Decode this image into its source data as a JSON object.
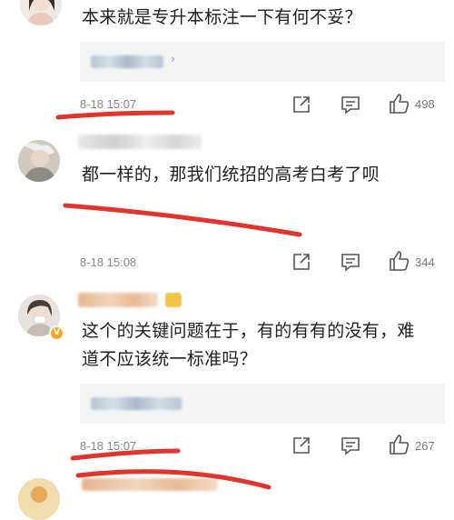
{
  "comments": [
    {
      "text": "本来就是专升本标注一下有何不妥？",
      "time": "8-18 15:07",
      "likes": "498",
      "reply_more": "›"
    },
    {
      "text": "都一样的，那我们统招的高考白考了呗",
      "time": "8-18 15:08",
      "likes": "344"
    },
    {
      "text_line1": "这个的关键问题在于，有的有有的没有，难",
      "text_line2": "道不应该统一标准吗？",
      "time": "8-18 15:07",
      "likes": "267"
    }
  ],
  "icons": {
    "share": "share-icon",
    "comment": "comment-icon",
    "like": "thumbs-up-icon",
    "verified": "verified-badge-icon"
  },
  "colors": {
    "annotation_red": "#e2342a",
    "time_gray": "#888888",
    "reply_bg": "#f4f4f4"
  }
}
